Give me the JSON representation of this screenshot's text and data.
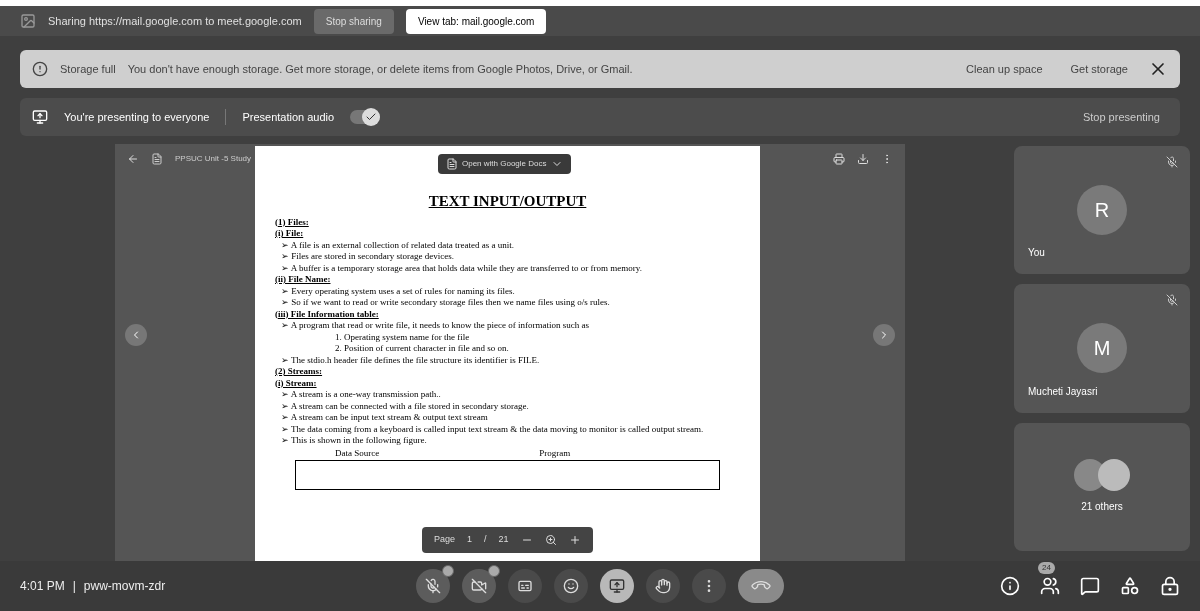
{
  "share_bar": {
    "text": "Sharing https://mail.google.com to meet.google.com",
    "stop_label": "Stop sharing",
    "view_label": "View tab: mail.google.com"
  },
  "storage_banner": {
    "title": "Storage full",
    "message": "You don't have enough storage. Get more storage, or delete items from Google Photos, Drive, or Gmail.",
    "actions": [
      "Clean up space",
      "Get storage"
    ]
  },
  "presenting_bar": {
    "text": "You're presenting to everyone",
    "audio_label": "Presentation audio",
    "audio_on": true,
    "stop_label": "Stop presenting"
  },
  "viewer": {
    "file_name": "PPSUC Unit -5 Study",
    "bullet_marker": "➢",
    "open_with": "Open with Google Docs",
    "page_label": "Page",
    "page": "1",
    "page_sep": "/",
    "page_total": "21",
    "lines": [
      {
        "kind": "title",
        "text": "TEXT INPUT/OUTPUT"
      },
      {
        "kind": "section",
        "text": "(1) Files:"
      },
      {
        "kind": "section",
        "text": "(i) File:"
      },
      {
        "kind": "bullet",
        "text": "A file is an external collection of related data treated as a unit."
      },
      {
        "kind": "bullet",
        "text": "Files are stored in secondary storage devices."
      },
      {
        "kind": "bullet",
        "text": "A buffer is a temporary storage area that holds data while they are transferred to or from memory."
      },
      {
        "kind": "section",
        "text": "(ii) File Name:"
      },
      {
        "kind": "bullet",
        "text": "Every operating system uses a set of rules for naming its files."
      },
      {
        "kind": "bullet",
        "text": "So if we want to read or write secondary storage files then we name files using o/s rules."
      },
      {
        "kind": "section",
        "text": "(iii) File Information table:"
      },
      {
        "kind": "bullet",
        "text": "A program that read or write file, it needs to know the piece of information such as"
      },
      {
        "kind": "numbered",
        "number": "1.",
        "text": "Operating system name for the file"
      },
      {
        "kind": "numbered",
        "number": "2.",
        "text": "Position of current character in file and so on."
      },
      {
        "kind": "bullet",
        "text": "The stdio.h header file defines the file structure its identifier is FILE."
      },
      {
        "kind": "section",
        "text": "(2) Streams:"
      },
      {
        "kind": "section",
        "text": "(i) Stream:"
      },
      {
        "kind": "bullet",
        "text": "A stream is a one-way transmission path.."
      },
      {
        "kind": "bullet",
        "text": "A stream can be connected with a file stored in secondary storage."
      },
      {
        "kind": "bullet",
        "text": "A stream can be input text stream & output text stream"
      },
      {
        "kind": "bullet",
        "text": "The data coming from a keyboard is called input text stream & the data moving to monitor is called output stream."
      },
      {
        "kind": "bullet",
        "text": "This is shown in the following figure."
      }
    ],
    "figure_labels": [
      "Data Source",
      "Program"
    ]
  },
  "participants": [
    {
      "initial": "R",
      "name": "You",
      "muted": true,
      "kind": "letter"
    },
    {
      "initial": "M",
      "name": "Mucheti Jayasri",
      "muted": true,
      "kind": "letter"
    },
    {
      "name": "21 others",
      "kind": "group"
    }
  ],
  "bottom_bar": {
    "time": "4:01 PM",
    "separator": "|",
    "meeting_code": "pww-movm-zdr",
    "people_count": "24",
    "controls": [
      {
        "kind": "mic",
        "off": true
      },
      {
        "kind": "camera",
        "off": true
      },
      {
        "kind": "captions",
        "off": false
      },
      {
        "kind": "emoji",
        "off": false
      },
      {
        "kind": "present",
        "off": false,
        "selected": true
      },
      {
        "kind": "hand",
        "off": false
      },
      {
        "kind": "more",
        "off": false
      },
      {
        "kind": "end",
        "off": false
      }
    ]
  }
}
